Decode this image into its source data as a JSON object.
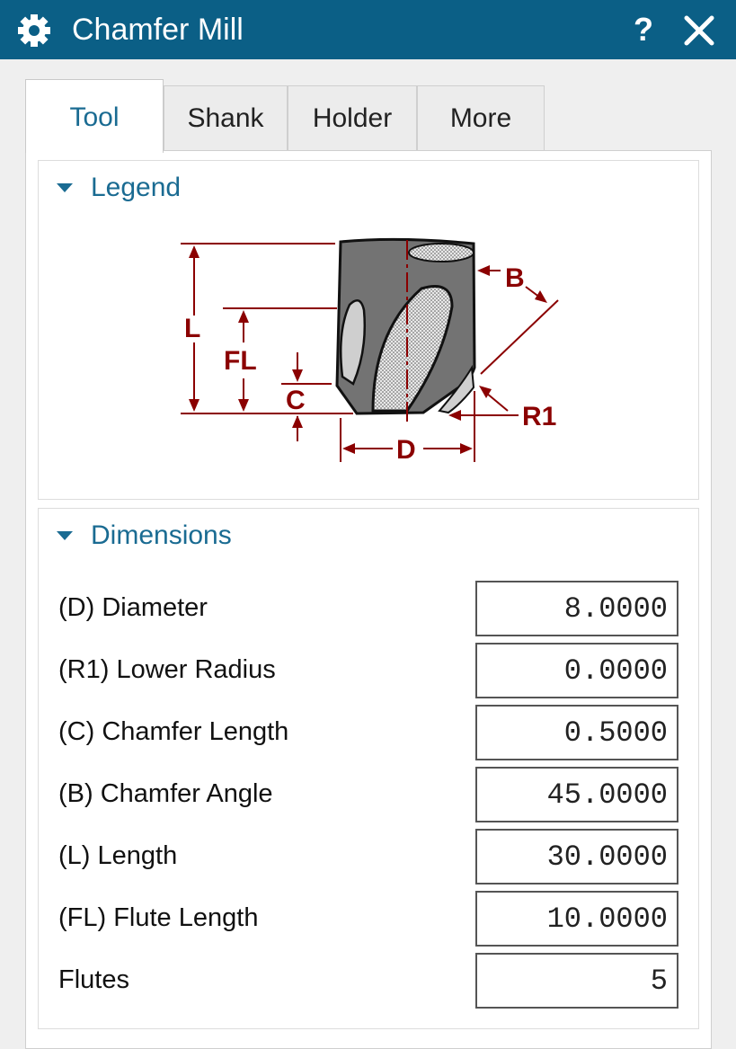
{
  "window": {
    "title": "Chamfer Mill",
    "help_label": "?",
    "colors": {
      "titlebar": "#0b5f86",
      "accent": "#1a6b92",
      "legend": "#8b0000"
    },
    "icons": {
      "app": "gear-icon",
      "close": "close-icon",
      "collapse": "triangle-down-icon"
    }
  },
  "tabs": [
    {
      "label": "Tool",
      "active": true
    },
    {
      "label": "Shank",
      "active": false
    },
    {
      "label": "Holder",
      "active": false
    },
    {
      "label": "More",
      "active": false
    }
  ],
  "legend": {
    "title": "Legend",
    "labels": {
      "L": "L",
      "FL": "FL",
      "C": "C",
      "D": "D",
      "B": "B",
      "R1": "R1"
    }
  },
  "dimensions": {
    "title": "Dimensions",
    "rows": [
      {
        "label": "(D) Diameter",
        "value": "8.0000"
      },
      {
        "label": "(R1) Lower Radius",
        "value": "0.0000"
      },
      {
        "label": "(C) Chamfer Length",
        "value": "0.5000"
      },
      {
        "label": "(B) Chamfer Angle",
        "value": "45.0000"
      },
      {
        "label": "(L) Length",
        "value": "30.0000"
      },
      {
        "label": "(FL) Flute Length",
        "value": "10.0000"
      },
      {
        "label": "Flutes",
        "value": "5"
      }
    ]
  }
}
